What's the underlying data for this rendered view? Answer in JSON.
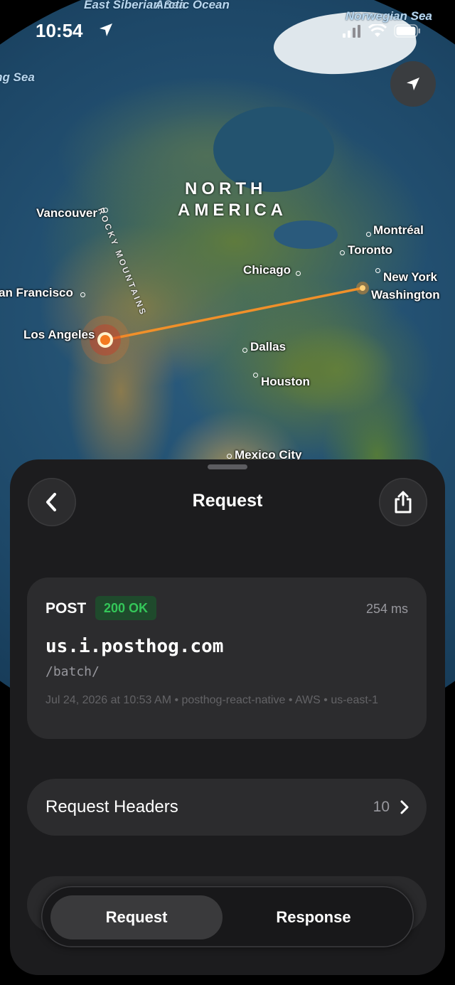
{
  "status_bar": {
    "time": "10:54"
  },
  "map": {
    "ocean_labels": [
      "East Siberian Sea",
      "Arctic Ocean",
      "Norwegian Sea",
      "Bering Sea"
    ],
    "region_label": [
      "NORTH",
      "AMERICA"
    ],
    "mountain_label": "ROCKY MOUNTAINS",
    "cities": {
      "vancouver": "Vancouver",
      "montreal": "Montréal",
      "toronto": "Toronto",
      "chicago": "Chicago",
      "new_york": "New York",
      "washington": "Washington",
      "san_francisco": "an Francisco",
      "los_angeles": "Los Angeles",
      "dallas": "Dallas",
      "houston": "Houston",
      "mexico_city": "Mexico City"
    },
    "route_color": "#f0902a"
  },
  "sheet": {
    "title": "Request",
    "request": {
      "method": "POST",
      "status": "200 OK",
      "duration": "254 ms",
      "host": "us.i.posthog.com",
      "path": "/batch/",
      "meta": "Jul 24, 2026 at 10:53 AM • posthog-react-native • AWS • us-east-1"
    },
    "headers_row": {
      "label": "Request Headers",
      "count": "10"
    },
    "tabs": [
      {
        "label": "Request",
        "active": true
      },
      {
        "label": "Response",
        "active": false
      }
    ]
  },
  "colors": {
    "status_green": "#34c759",
    "sheet_bg": "#1c1c1e",
    "card_bg": "#2c2c2e"
  }
}
